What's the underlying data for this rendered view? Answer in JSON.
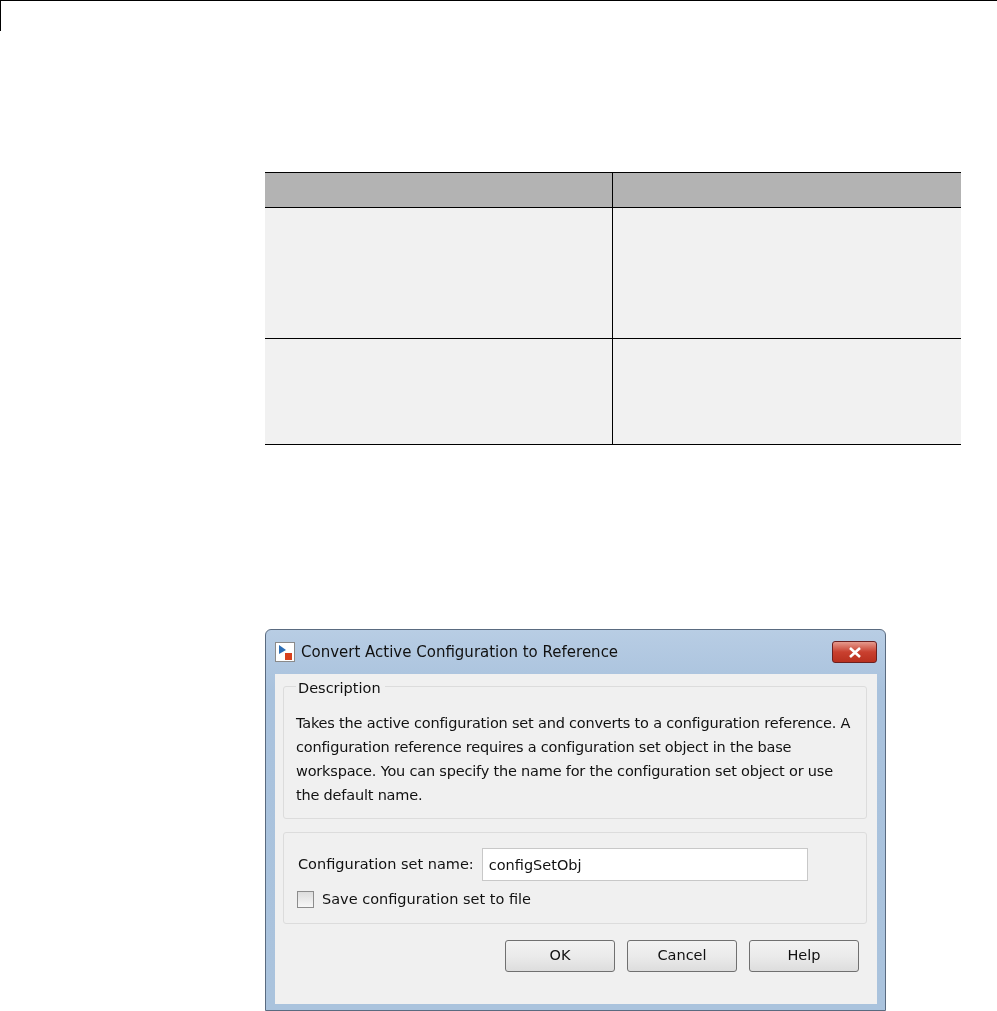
{
  "dialog": {
    "title": "Convert Active Configuration to Reference",
    "description": {
      "label": "Description",
      "text": "Takes the active configuration set and converts to a configuration reference. A configuration reference requires a configuration set object in the base workspace. You can specify the name for the configuration set object or use the default name."
    },
    "name_field": {
      "label": "Configuration set name:",
      "value": "configSetObj"
    },
    "save_checkbox": {
      "label": "Save configuration set to file",
      "checked": false
    },
    "buttons": [
      "OK",
      "Cancel",
      "Help"
    ]
  }
}
